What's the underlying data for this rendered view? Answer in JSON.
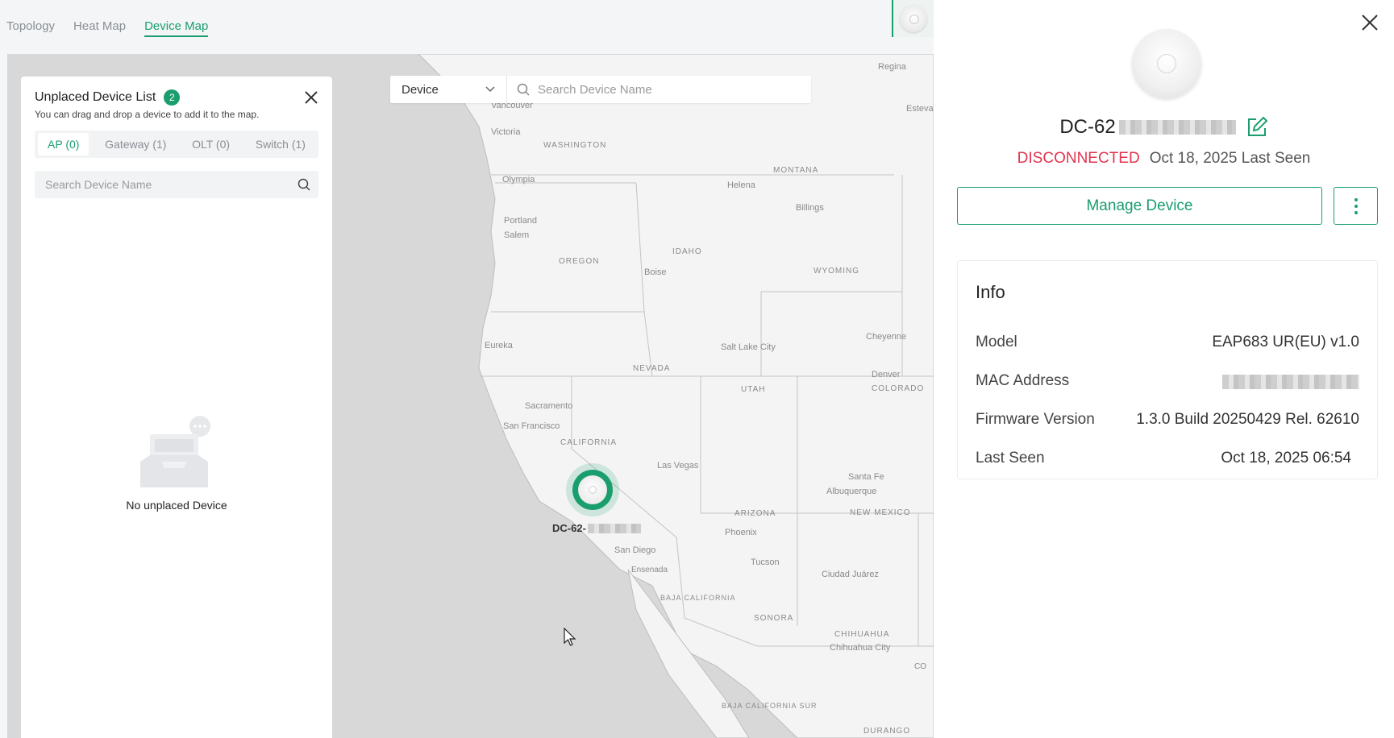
{
  "tabs": [
    {
      "label": "Topology",
      "active": false
    },
    {
      "label": "Heat Map",
      "active": false
    },
    {
      "label": "Device Map",
      "active": true
    }
  ],
  "map_search": {
    "type_select": "Device",
    "placeholder": "Search Device Name"
  },
  "map_labels": [
    "Vancouver",
    "Victoria",
    "WASHINGTON",
    "Olympia",
    "Portland",
    "Salem",
    "OREGON",
    "IDAHO",
    "Boise",
    "MONTANA",
    "Helena",
    "Billings",
    "WYOMING",
    "Cheyenne",
    "Regina",
    "Estevan",
    "NEVADA",
    "UTAH",
    "Salt Lake City",
    "Denver",
    "COLORADO",
    "Eureka",
    "Sacramento",
    "San Francisco",
    "CALIFORNIA",
    "Las Vegas",
    "Santa Fe",
    "Albuquerque",
    "NEW MEXICO",
    "ARIZONA",
    "Phoenix",
    "Tucson",
    "San Diego",
    "Ensenada",
    "BAJA CALIFORNIA",
    "Ciudad Juárez",
    "SONORA",
    "CHIHUAHUA",
    "Chihuahua City",
    "BAJA CALIFORNIA SUR",
    "DURANGO",
    "CO"
  ],
  "unplaced": {
    "title": "Unplaced Device List",
    "count": "2",
    "hint": "You can drag and drop a device to add it to the map.",
    "segments": [
      {
        "label": "AP (0)",
        "active": true
      },
      {
        "label": "Gateway (1)",
        "active": false
      },
      {
        "label": "OLT (0)",
        "active": false
      },
      {
        "label": "Switch (1)",
        "active": false
      }
    ],
    "search_placeholder": "Search Device Name",
    "empty_text": "No unplaced Device"
  },
  "marker": {
    "label_prefix": "DC-62-"
  },
  "device": {
    "name_prefix": "DC-62",
    "status": "DISCONNECTED",
    "last_seen_text": "Oct 18, 2025 Last Seen",
    "manage_label": "Manage Device",
    "info_title": "Info",
    "info": [
      {
        "label": "Model",
        "value": "EAP683 UR(EU) v1.0"
      },
      {
        "label": "MAC Address",
        "value": ""
      },
      {
        "label": "Firmware Version",
        "value": "1.3.0 Build 20250429 Rel. 62610"
      },
      {
        "label": "Last Seen",
        "value": "Oct 18, 2025 06:54"
      }
    ]
  },
  "colors": {
    "accent": "#1a9e6e",
    "status_disconnected": "#e2344f"
  }
}
